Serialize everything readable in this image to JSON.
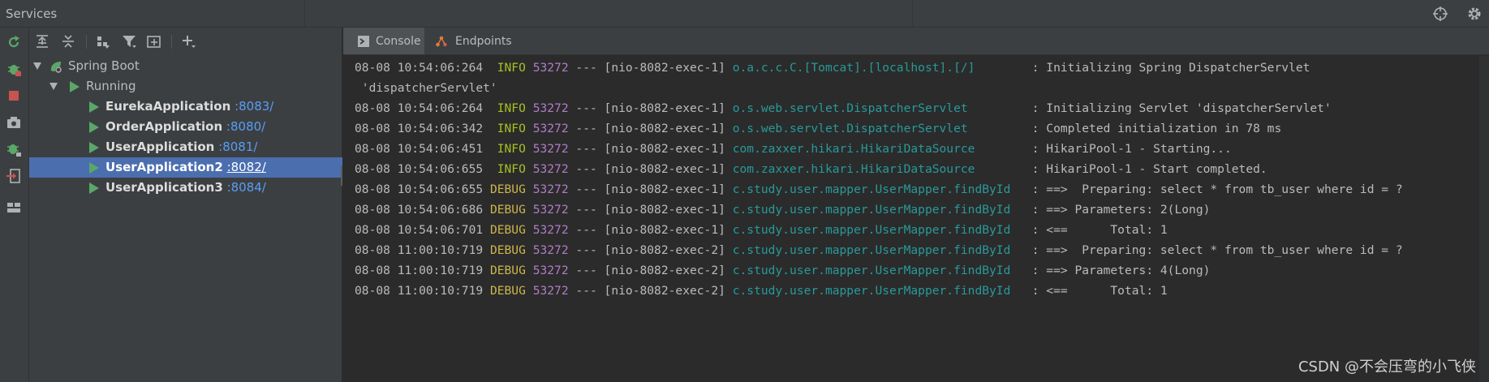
{
  "window": {
    "title": "Services"
  },
  "left_toolbar": {
    "icons": [
      "rerun-icon",
      "debug-icon",
      "stop-icon",
      "snapshot-icon",
      "attach-debugger-icon",
      "exit-icon",
      "layout-icon"
    ]
  },
  "tree_toolbar": {
    "icons": [
      "expand-all-icon",
      "collapse-all-icon",
      "group-by-icon",
      "filter-icon",
      "new-tab-icon",
      "add-service-icon"
    ]
  },
  "tree": {
    "root": {
      "label": "Spring Boot"
    },
    "group": {
      "label": "Running"
    },
    "apps": [
      {
        "name": "EurekaApplication",
        "port": ":8083/",
        "selected": false
      },
      {
        "name": "OrderApplication",
        "port": ":8080/",
        "selected": false
      },
      {
        "name": "UserApplication",
        "port": ":8081/",
        "selected": false
      },
      {
        "name": "UserApplication2",
        "port": ":8082/",
        "selected": true
      },
      {
        "name": "UserApplication3",
        "port": ":8084/",
        "selected": false
      }
    ]
  },
  "tabs": [
    {
      "label": "Console",
      "active": true
    },
    {
      "label": "Endpoints",
      "active": false
    }
  ],
  "log_lines": [
    {
      "ts": "08-08 10:54:06:264",
      "level": " INFO",
      "pid": "53272",
      "thread": " --- [nio-8082-exec-1] ",
      "logger": "o.a.c.c.C.[Tomcat].[localhost].[/]       ",
      "msg": " : Initializing Spring DispatcherServlet"
    },
    {
      "cont": " 'dispatcherServlet'"
    },
    {
      "ts": "08-08 10:54:06:264",
      "level": " INFO",
      "pid": "53272",
      "thread": " --- [nio-8082-exec-1] ",
      "logger": "o.s.web.servlet.DispatcherServlet        ",
      "msg": " : Initializing Servlet 'dispatcherServlet'"
    },
    {
      "ts": "08-08 10:54:06:342",
      "level": " INFO",
      "pid": "53272",
      "thread": " --- [nio-8082-exec-1] ",
      "logger": "o.s.web.servlet.DispatcherServlet        ",
      "msg": " : Completed initialization in 78 ms"
    },
    {
      "ts": "08-08 10:54:06:451",
      "level": " INFO",
      "pid": "53272",
      "thread": " --- [nio-8082-exec-1] ",
      "logger": "com.zaxxer.hikari.HikariDataSource       ",
      "msg": " : HikariPool-1 - Starting..."
    },
    {
      "ts": "08-08 10:54:06:655",
      "level": " INFO",
      "pid": "53272",
      "thread": " --- [nio-8082-exec-1] ",
      "logger": "com.zaxxer.hikari.HikariDataSource       ",
      "msg": " : HikariPool-1 - Start completed."
    },
    {
      "ts": "08-08 10:54:06:655",
      "level": "DEBUG",
      "pid": "53272",
      "thread": " --- [nio-8082-exec-1] ",
      "logger": "c.study.user.mapper.UserMapper.findById  ",
      "msg": " : ==>  Preparing: select * from tb_user where id = ?"
    },
    {
      "ts": "08-08 10:54:06:686",
      "level": "DEBUG",
      "pid": "53272",
      "thread": " --- [nio-8082-exec-1] ",
      "logger": "c.study.user.mapper.UserMapper.findById  ",
      "msg": " : ==> Parameters: 2(Long)"
    },
    {
      "ts": "08-08 10:54:06:701",
      "level": "DEBUG",
      "pid": "53272",
      "thread": " --- [nio-8082-exec-1] ",
      "logger": "c.study.user.mapper.UserMapper.findById  ",
      "msg": " : <==      Total: 1"
    },
    {
      "ts": "08-08 11:00:10:719",
      "level": "DEBUG",
      "pid": "53272",
      "thread": " --- [nio-8082-exec-2] ",
      "logger": "c.study.user.mapper.UserMapper.findById  ",
      "msg": " : ==>  Preparing: select * from tb_user where id = ?"
    },
    {
      "ts": "08-08 11:00:10:719",
      "level": "DEBUG",
      "pid": "53272",
      "thread": " --- [nio-8082-exec-2] ",
      "logger": "c.study.user.mapper.UserMapper.findById  ",
      "msg": " : ==> Parameters: 4(Long)"
    },
    {
      "ts": "08-08 11:00:10:719",
      "level": "DEBUG",
      "pid": "53272",
      "thread": " --- [nio-8082-exec-2] ",
      "logger": "c.study.user.mapper.UserMapper.findById  ",
      "msg": " : <==      Total: 1"
    }
  ],
  "watermark": "CSDN @不会压弯的小飞侠",
  "colors": {
    "info": "#a8c023",
    "debug": "#cdb54b",
    "pid": "#b07dc7",
    "logger": "#299999",
    "run_green": "#59a869",
    "stop_red": "#c75450",
    "selection": "#4b6eaf",
    "port": "#589df6"
  }
}
